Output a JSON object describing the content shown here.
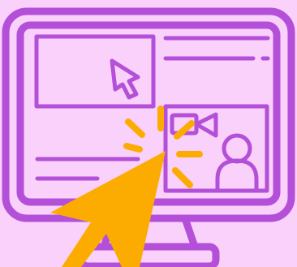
{
  "colors": {
    "background": "#FAD1FA",
    "line": "#B34FD8",
    "cursor_accent": "#FCAC00"
  },
  "icons": {
    "monitor": "desktop-monitor-icon",
    "small_cursor": "pointer-cursor-icon",
    "video_camera": "video-camera-icon",
    "person": "person-icon",
    "large_cursor": "pointer-cursor-icon",
    "click_burst": "click-burst-icon"
  }
}
